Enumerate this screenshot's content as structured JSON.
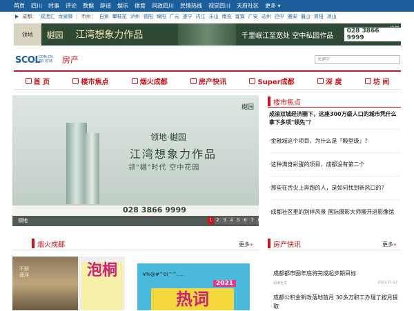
{
  "topnav": [
    "首页",
    "四川",
    "时事",
    "评论",
    "数据",
    "辟谣",
    "娱乐",
    "体育",
    "问政四川",
    "民情热线",
    "视觉四川",
    "天府社区",
    "更多 ▾"
  ],
  "subnav": {
    "marker": "▶",
    "cd_label": "成都：",
    "cd": [
      "双流汇",
      "龙泉驿"
    ],
    "city_label": "市州：",
    "cities": [
      "自贡",
      "攀枝花",
      "泸州",
      "德阳",
      "绵阳",
      "广元",
      "遂宁",
      "内江",
      "乐山",
      "南充",
      "宜宾",
      "广安",
      "达州",
      "巴中",
      "雅安",
      "眉山",
      "资阳",
      "凉山"
    ]
  },
  "banner": {
    "brand_a": "领地",
    "brand_b": "樾园",
    "slogan": "江湾想象力作品",
    "slogan2": "千里岷江至宽处 空中私园作品",
    "phone": "028 3866 9999",
    "ad_label": "广告"
  },
  "header": {
    "logo": "SCOL",
    "logo_sub_1": "COM.CN",
    "logo_sub_2": "四川在线",
    "channel": "房产",
    "search_placeholder": "关键字"
  },
  "mainnav": [
    "首 页",
    "楼市焦点",
    "烟火成都",
    "房产快讯",
    "Super成都",
    "深 度",
    "坊 间"
  ],
  "hero": {
    "brand": "樾园",
    "line1": "领地·樾园",
    "line2": "江湾想象力作品",
    "line3": "领\"樾\"时代  空中花园",
    "phone": "028 3866 9999",
    "caption": "领地",
    "pages": [
      "1",
      "2",
      "3",
      "4",
      "5",
      "6",
      "7",
      "8",
      "9",
      "10"
    ],
    "active_page": 1
  },
  "focus": {
    "title": "楼市焦点",
    "items": [
      "成渝双城经济圈下，这座300万级人口的城市凭什么拿下多项\"领先\"？",
      "·金融城这个项目，为什么是「殿堂级」？",
      "·这种满身彩蛋的项目，成都没有第二个",
      "·那些在舌尖上奔跑的人，是如何找到新风口的？",
      "·成都社区里的别样风景 国际摄影大师展开进影像馆"
    ]
  },
  "yanhuo": {
    "title": "烟火成都",
    "more": "更多",
    "thumb1_text": "不解藏洋",
    "thumb1_big": "泡桐",
    "thumb2_code": "¥%@#^0(^^.....",
    "thumb2_year": "2021",
    "thumb2_big": "热词"
  },
  "kuaixun": {
    "title": "房产快讯",
    "more": "更多",
    "item1": "成都都市圈年底将完成起步期目标",
    "item1_read": "阅读全文",
    "item1_date": "2021-11-12",
    "item2": "成都公积金新政落地首月 30多万职工办理了按月提取"
  }
}
